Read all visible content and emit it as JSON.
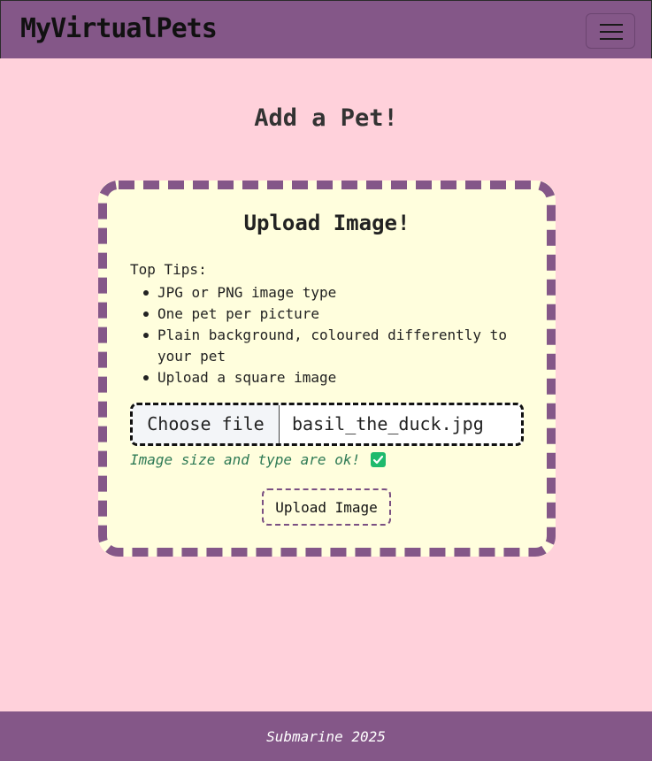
{
  "navbar": {
    "brand": "MyVirtualPets",
    "toggle_icon": "hamburger-menu-icon"
  },
  "page": {
    "title": "Add a Pet!"
  },
  "upload_card": {
    "title": "Upload Image!",
    "tips_heading": "Top Tips:",
    "tips": [
      "JPG or PNG image type",
      "One pet per picture",
      "Plain background, coloured differently to your pet",
      "Upload a square image"
    ],
    "file_input": {
      "button_label": "Choose file",
      "file_name": "basil_the_duck.jpg"
    },
    "status_message": "Image size and type are ok!",
    "status_icon": "checkbox-checked-icon",
    "upload_button_label": "Upload Image"
  },
  "footer": {
    "text": "Submarine 2025"
  },
  "colors": {
    "background": "#ffd1db",
    "brand_purple": "#845788",
    "card_background": "#fffedd",
    "success_green": "#1fba6d"
  }
}
